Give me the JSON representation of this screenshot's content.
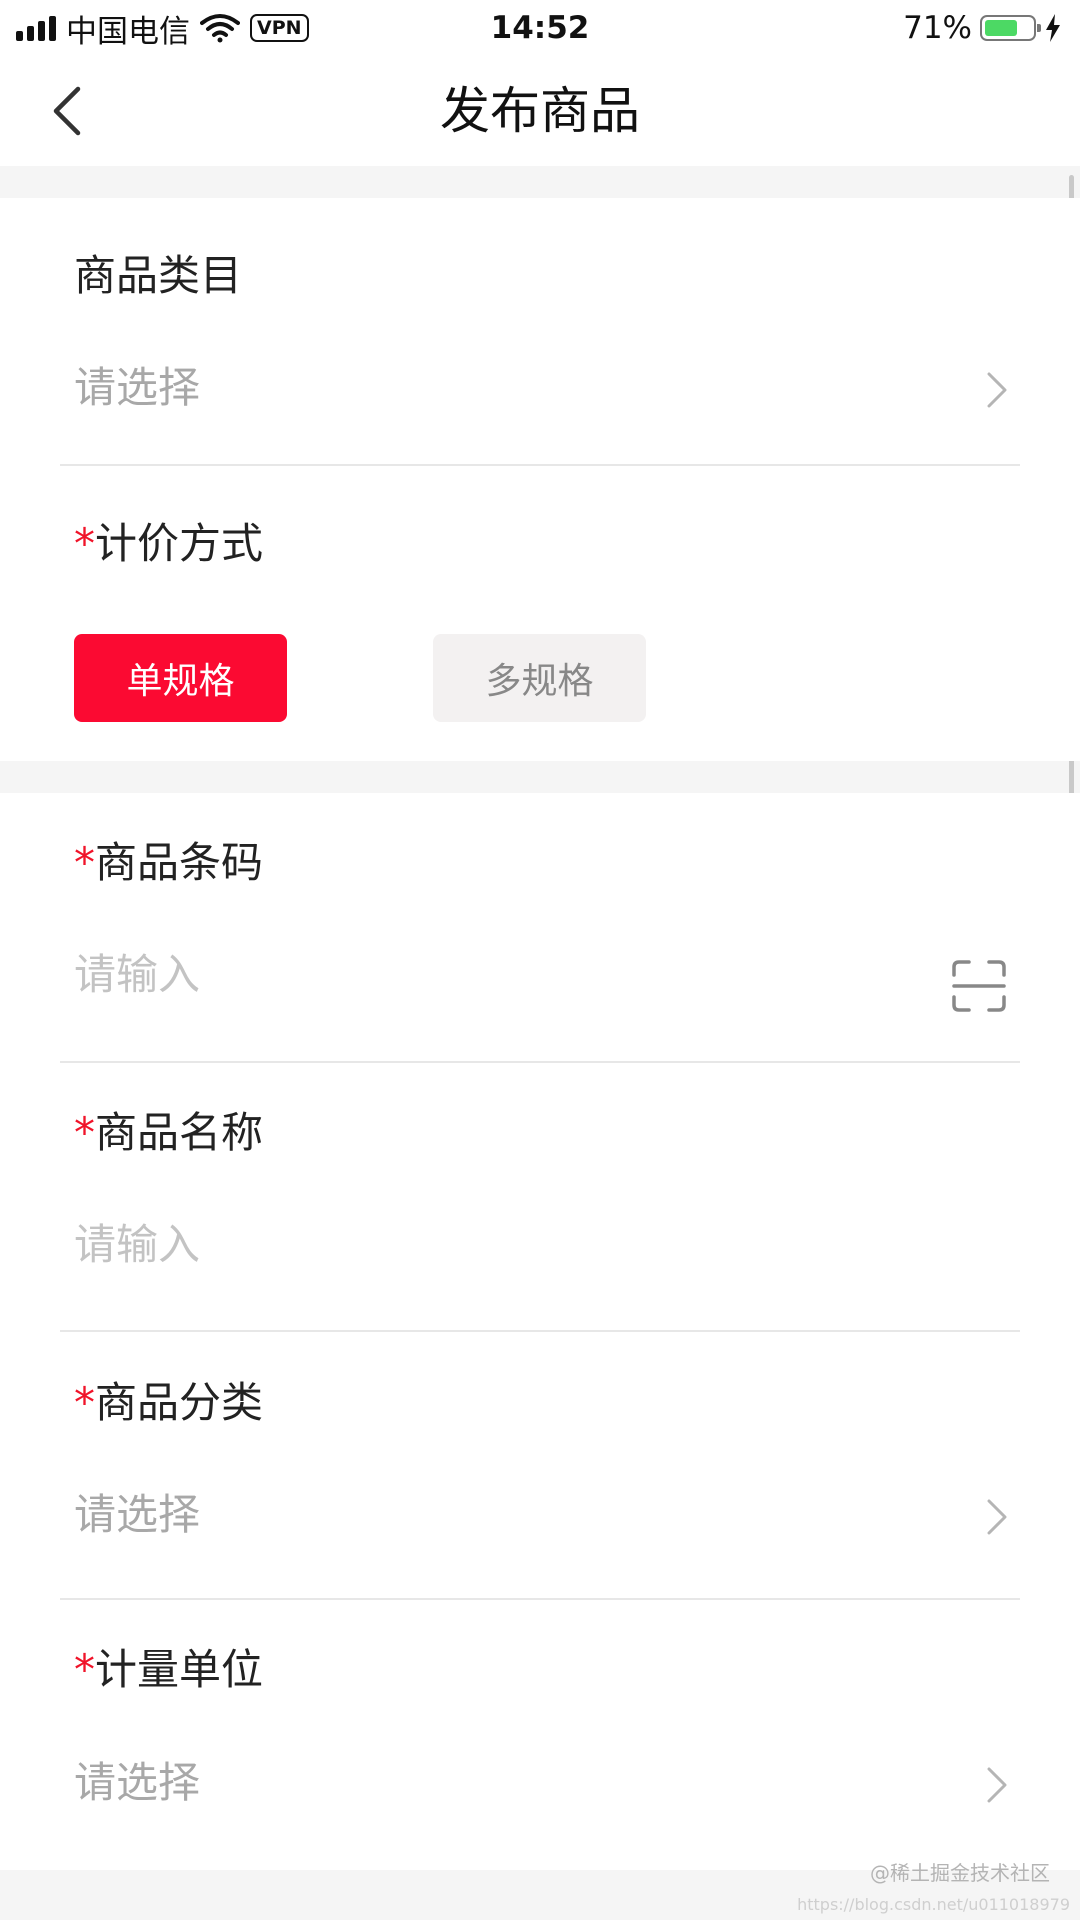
{
  "status_bar": {
    "carrier": "中国电信",
    "vpn": "VPN",
    "time": "14:52",
    "battery_percent_text": "71%",
    "battery_level": 0.71
  },
  "nav": {
    "title": "发布商品",
    "back_icon": "chevron-left-icon"
  },
  "form": {
    "category": {
      "label": "商品类目",
      "placeholder": "请选择"
    },
    "pricing": {
      "required_mark": "*",
      "label": "计价方式",
      "options": [
        "单规格",
        "多规格"
      ],
      "selected": "单规格"
    },
    "barcode": {
      "required_mark": "*",
      "label": "商品条码",
      "placeholder": "请输入",
      "icon": "scan-icon"
    },
    "name": {
      "required_mark": "*",
      "label": "商品名称",
      "placeholder": "请输入"
    },
    "classification": {
      "required_mark": "*",
      "label": "商品分类",
      "placeholder": "请选择"
    },
    "unit": {
      "required_mark": "*",
      "label": "计量单位",
      "placeholder": "请选择"
    }
  },
  "watermark": {
    "line1": "@稀土掘金技术社区",
    "line2": "https://blog.csdn.net/u011018979"
  },
  "colors": {
    "accent": "#fb0a32",
    "required": "#f0142a",
    "placeholder": "#a8a8a8",
    "battery": "#4cd964"
  }
}
